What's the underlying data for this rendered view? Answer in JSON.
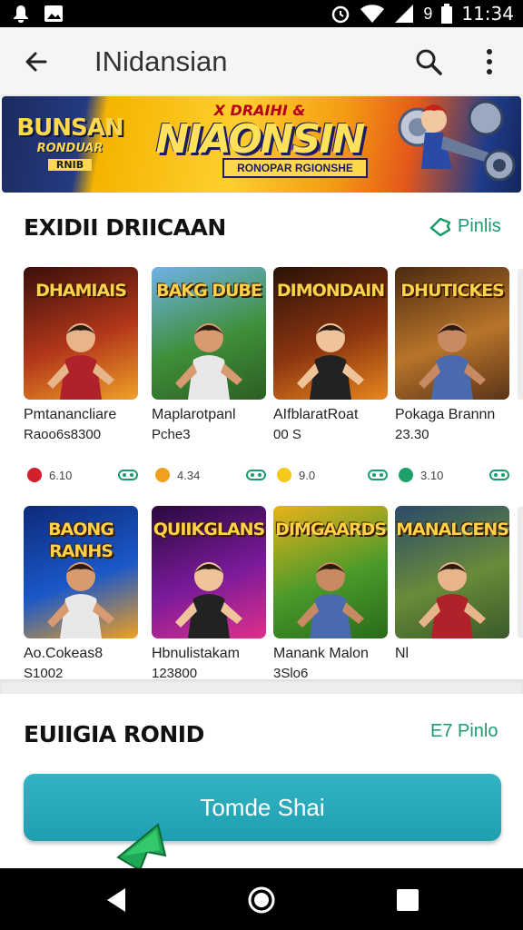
{
  "status_bar": {
    "time": "11:34",
    "indicator": "9",
    "icons": [
      "notification-icon",
      "image-icon",
      "alarm-icon",
      "wifi-icon",
      "signal-icon",
      "battery-icon"
    ]
  },
  "app_bar": {
    "title": "INidansian",
    "back_icon": "arrow-left-icon",
    "search_icon": "search-icon",
    "more_icon": "more-vert-icon"
  },
  "banner": {
    "left_logo_line1": "BUNSAN",
    "left_logo_line2": "RONDUAR",
    "left_logo_tag": "RNIB",
    "top_text": "X DRAIHI &",
    "main_title": "NIAONSIN",
    "subtitle": "RONOPAR RGIONSHE"
  },
  "section1": {
    "title": "EXIDII DRIICAAN",
    "more_label": "Pinlis",
    "games": [
      {
        "thumb_title": "DHAMIAIS",
        "name": "Pmtanancliare",
        "sub": "Raoo6s8300",
        "rating": "6.10",
        "dot_color": "#d0202a",
        "bg": [
          "#3a0f0c",
          "#b2371a",
          "#f0a028"
        ]
      },
      {
        "thumb_title": "BAKG DUBE",
        "name": "Maplarotpanl",
        "sub": "Pche3",
        "rating": "4.34",
        "dot_color": "#f0a020",
        "bg": [
          "#6fb2e8",
          "#3f8f3a",
          "#2c5e22"
        ]
      },
      {
        "thumb_title": "DIMONDAIN",
        "name": "AIfblaratRoat",
        "sub": "00 S",
        "rating": "9.0",
        "dot_color": "#f5c81c",
        "bg": [
          "#2a1208",
          "#8a3410",
          "#e8861e"
        ]
      },
      {
        "thumb_title": "DHUTICKES",
        "name": "Pokaga Brannn",
        "sub": "23.30",
        "rating": "3.10",
        "dot_color": "#1fa06a",
        "bg": [
          "#4a2a10",
          "#b8742a",
          "#5a3418"
        ]
      }
    ]
  },
  "section1_row2": {
    "games": [
      {
        "thumb_title": "BAONG RANHS",
        "name": "Ao.Cokeas8",
        "sub": "S1002",
        "bg": [
          "#0e2a7a",
          "#1a58c8",
          "#f0a020"
        ]
      },
      {
        "thumb_title": "QUIIKGLANS",
        "name": "Hbnulistakam",
        "sub": "123800",
        "bg": [
          "#2a0a3e",
          "#7a1a9a",
          "#e0308a"
        ]
      },
      {
        "thumb_title": "DIMGAARDS",
        "name": "Manank Malon",
        "sub": "3Slo6",
        "bg": [
          "#e8b21a",
          "#4a9a2a",
          "#2a6a1a"
        ]
      },
      {
        "thumb_title": "MANALCENS",
        "name": "Nl",
        "sub": "",
        "bg": [
          "#2a4a6a",
          "#6a8a3a",
          "#3a5a2a"
        ]
      }
    ]
  },
  "section2": {
    "title": "EUIIGIA RONID",
    "more_label": "E7 Pinlo"
  },
  "cta": {
    "label": "Tomde Shai"
  },
  "nav": {
    "back_icon": "nav-back-icon",
    "home_icon": "nav-home-icon",
    "recents_icon": "nav-recents-icon"
  }
}
